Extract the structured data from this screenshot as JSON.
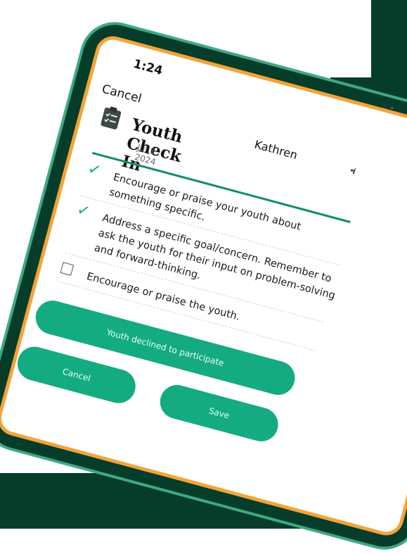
{
  "status": {
    "time": "1:24",
    "signal": "•ıl"
  },
  "header": {
    "cancel_label": "Cancel",
    "user_name": "Kathren"
  },
  "form": {
    "icon": "clipboard-checklist-icon",
    "title": "Youth Check In",
    "date": "Jul 1, 2024",
    "items": [
      {
        "checked": true,
        "text": "Encourage or praise your youth about something specific."
      },
      {
        "checked": true,
        "text": "Address a specific goal/concern. Remember to ask the youth for their input on problem-solving and forward-thinking."
      },
      {
        "checked": false,
        "text": "Encourage or praise the youth."
      }
    ]
  },
  "actions": {
    "declined_label": "Youth declined to participate",
    "cancel_label": "Cancel",
    "save_label": "Save"
  },
  "colors": {
    "accent_green": "#14ab80",
    "dark_green": "#063c2a",
    "frame_orange": "#f2a43a"
  }
}
